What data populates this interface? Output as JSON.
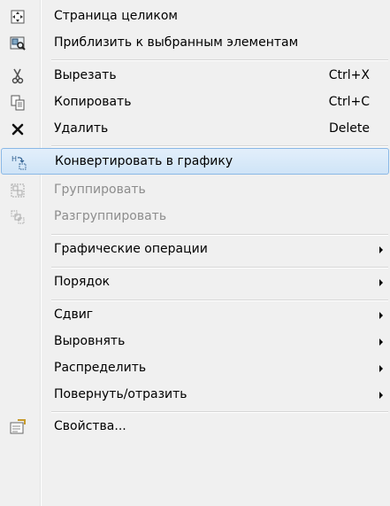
{
  "menu": {
    "items": [
      {
        "label": "Страница целиком",
        "icon": "full-page-icon"
      },
      {
        "label": "Приблизить к выбранным элементам",
        "icon": "zoom-to-selected-icon"
      },
      {
        "label": "Вырезать",
        "shortcut": "Ctrl+X",
        "icon": "scissors-icon"
      },
      {
        "label": "Копировать",
        "shortcut": "Ctrl+C",
        "icon": "copy-icon"
      },
      {
        "label": "Удалить",
        "shortcut": "Delete",
        "icon": "delete-x-icon"
      },
      {
        "label": "Конвертировать в графику",
        "icon": "convert-to-graphics-icon",
        "highlighted": true
      },
      {
        "label": "Группировать",
        "icon": "group-icon",
        "disabled": true
      },
      {
        "label": "Разгруппировать",
        "icon": "ungroup-icon",
        "disabled": true
      },
      {
        "label": "Графические операции",
        "submenu": true
      },
      {
        "label": "Порядок",
        "submenu": true
      },
      {
        "label": "Сдвиг",
        "submenu": true
      },
      {
        "label": "Выровнять",
        "submenu": true
      },
      {
        "label": "Распределить",
        "submenu": true
      },
      {
        "label": "Повернуть/отразить",
        "submenu": true
      },
      {
        "label": "Свойства...",
        "icon": "properties-icon"
      }
    ]
  },
  "colors": {
    "highlight_border": "#8ab8e6",
    "highlight_fill": "#cfe4f7",
    "disabled_text": "#8d8d8d",
    "menu_background": "#f0f0f0"
  }
}
